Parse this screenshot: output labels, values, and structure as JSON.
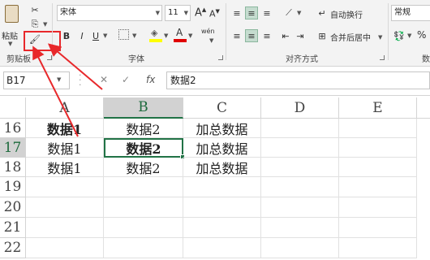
{
  "ribbon": {
    "clipboard": {
      "paste_label": "粘贴",
      "group_label": "剪贴板"
    },
    "font": {
      "font_name": "宋体",
      "font_size": "11",
      "bold": "B",
      "italic": "I",
      "underline": "U",
      "group_label": "字体",
      "phonetic": "wén",
      "font_color_letter": "A",
      "grow_letter": "A",
      "shrink_letter": "A"
    },
    "alignment": {
      "wrap_label": "自动换行",
      "merge_label": "合并后居中",
      "group_label": "对齐方式"
    },
    "number": {
      "format": "常规",
      "group_label": "数",
      "percent": "%"
    }
  },
  "formula_bar": {
    "name_box": "B17",
    "fx": "fx",
    "formula": "数据2"
  },
  "columns": [
    "A",
    "B",
    "C",
    "D",
    "E"
  ],
  "rows": [
    {
      "num": "16",
      "cells": [
        "数据1",
        "数据2",
        "加总数据"
      ]
    },
    {
      "num": "17",
      "cells": [
        "数据1",
        "数据2",
        "加总数据"
      ]
    },
    {
      "num": "18",
      "cells": [
        "数据1",
        "数据2",
        "加总数据"
      ]
    },
    {
      "num": "19",
      "cells": [
        "",
        "",
        ""
      ]
    },
    {
      "num": "20",
      "cells": [
        "",
        "",
        ""
      ]
    },
    {
      "num": "21",
      "cells": [
        "",
        "",
        ""
      ]
    },
    {
      "num": "22",
      "cells": [
        "",
        "",
        ""
      ]
    }
  ],
  "colors": {
    "accent": "#217346",
    "annotation": "#e8282b"
  }
}
